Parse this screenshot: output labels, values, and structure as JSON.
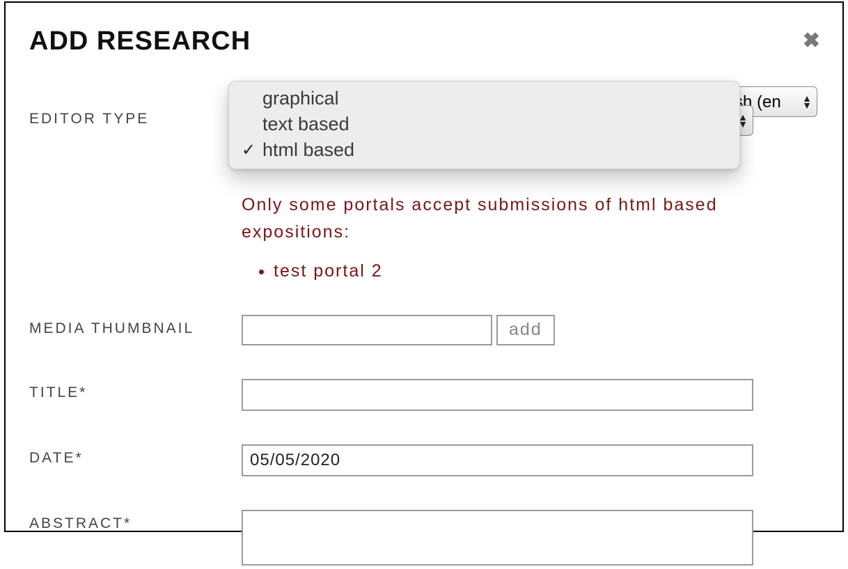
{
  "dialog": {
    "title": "ADD RESEARCH"
  },
  "language_select": {
    "visible_label": "sh (en"
  },
  "editor_type": {
    "label": "EDITOR TYPE",
    "options": [
      "graphical",
      "text based",
      "html based"
    ],
    "selected": "html based",
    "warning_text": "Only some portals accept submissions of html based expositions:",
    "accepted_portals": [
      "test portal 2"
    ]
  },
  "media_thumbnail": {
    "label": "MEDIA THUMBNAIL",
    "value": "",
    "add_button": "add"
  },
  "title_field": {
    "label": "TITLE*",
    "value": ""
  },
  "date_field": {
    "label": "DATE*",
    "value": "05/05/2020"
  },
  "abstract_field": {
    "label": "ABSTRACT*",
    "value": ""
  }
}
